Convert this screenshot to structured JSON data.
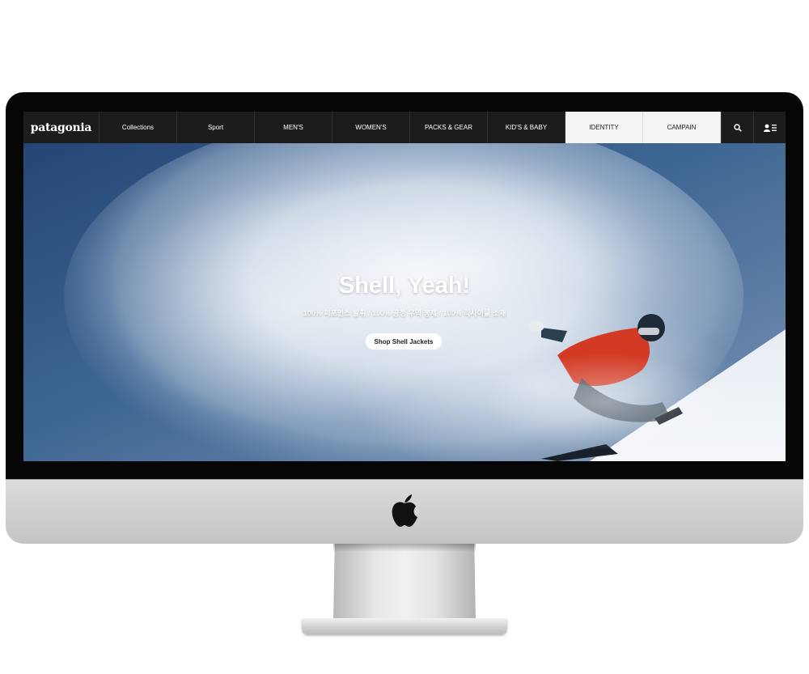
{
  "brand": {
    "logo_text": "patagonia"
  },
  "nav": {
    "items": [
      {
        "label": "Collections"
      },
      {
        "label": "Sport"
      },
      {
        "label": "MEN'S"
      },
      {
        "label": "WOMEN'S"
      },
      {
        "label": "PACKS & GEAR"
      },
      {
        "label": "KID'S & BABY"
      },
      {
        "label": "IDENTITY"
      },
      {
        "label": "CAMPAIN"
      }
    ],
    "icons": [
      "search-icon",
      "account-menu-icon"
    ]
  },
  "hero": {
    "title": "Shell, Yeah!",
    "subtitle": "100% 퍼포먼스 발휘 / 100% 공정 무역 봉제 / 100% 리사이클 소재",
    "cta_label": "Shop Shell Jackets"
  },
  "device": {
    "logo_icon": "apple-logo-icon"
  },
  "colors": {
    "nav_bg": "#1c1c1c",
    "nav_highlight": "#f4f4f4",
    "jacket_red": "#d33a24",
    "sky_blue": "#2b4a73"
  }
}
